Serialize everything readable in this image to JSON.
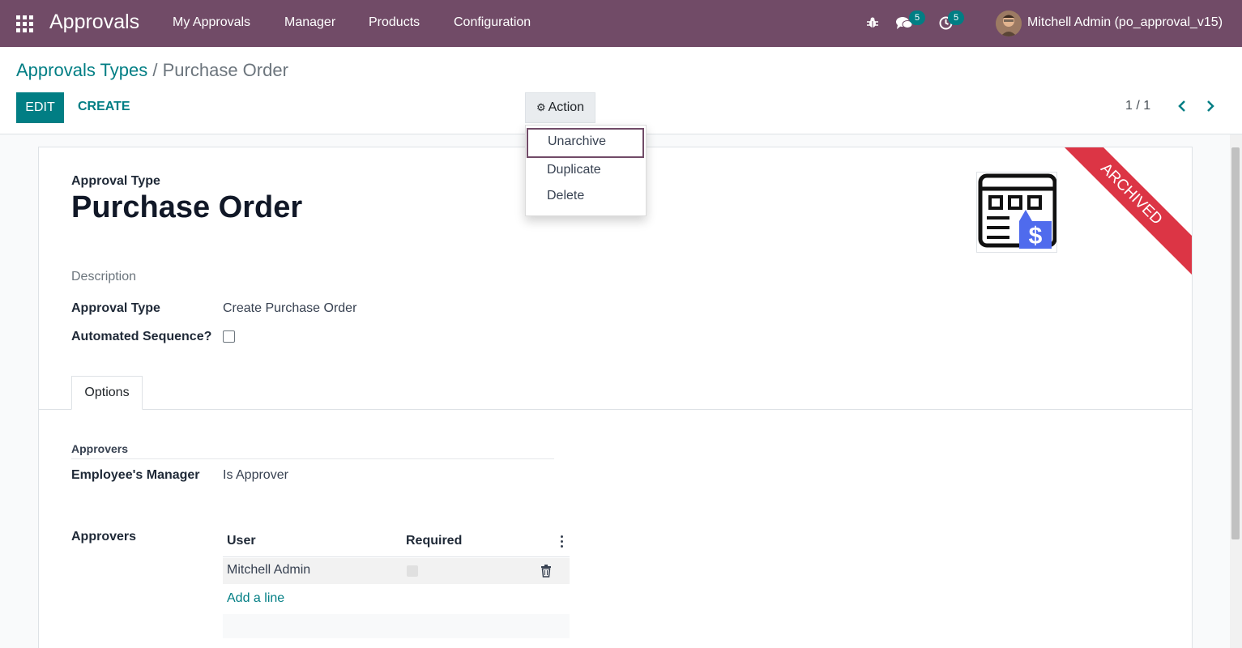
{
  "navbar": {
    "app_name": "Approvals",
    "menu": [
      "My Approvals",
      "Manager",
      "Products",
      "Configuration"
    ],
    "messages_badge": "5",
    "activities_badge": "5",
    "user_name": "Mitchell Admin (po_approval_v15)",
    "icons": [
      "apps-grid-icon",
      "bug-icon",
      "chat-icon",
      "clock-icon"
    ],
    "color": "#714b67"
  },
  "breadcrumb": {
    "parent": "Approvals Types",
    "separator": "/",
    "current": "Purchase Order"
  },
  "toolbar": {
    "edit_label": "EDIT",
    "create_label": "CREATE",
    "action_label": "Action",
    "pager": "1 / 1"
  },
  "action_menu": {
    "items": [
      "Unarchive",
      "Duplicate",
      "Delete"
    ],
    "focused_item": "Unarchive"
  },
  "form": {
    "type_caption": "Approval Type",
    "title": "Purchase Order",
    "ribbon": "ARCHIVED",
    "ribbon_color": "#dc3545",
    "description_placeholder": "Description",
    "fields": {
      "approval_type_label": "Approval Type",
      "approval_type_value": "Create Purchase Order",
      "automated_sequence_label": "Automated Sequence?",
      "automated_sequence_checked": false
    },
    "tabs": [
      "Options"
    ],
    "approvers_group_title": "Approvers",
    "manager_label": "Employee's Manager",
    "manager_value": "Is Approver",
    "approvers_label": "Approvers",
    "approvers_table": {
      "columns": [
        "User",
        "Required"
      ],
      "rows": [
        {
          "user": "Mitchell Admin",
          "required": false
        }
      ],
      "add_line_label": "Add a line"
    }
  },
  "accent_color": "#017e84"
}
